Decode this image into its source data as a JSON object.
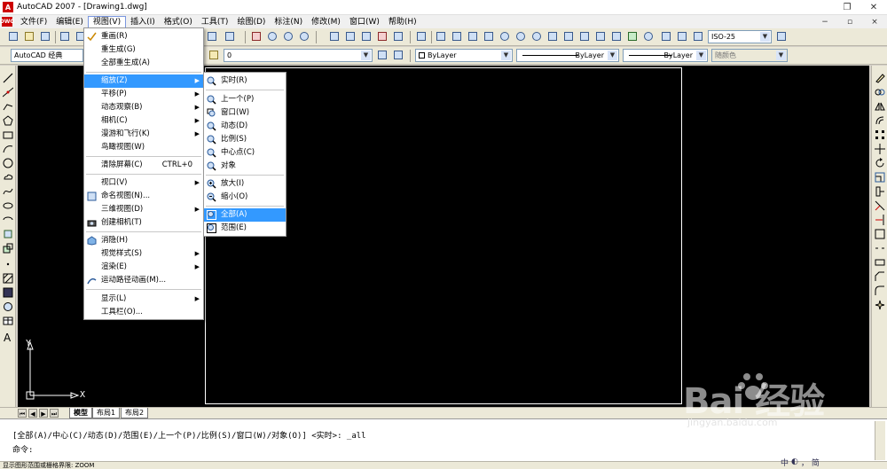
{
  "window": {
    "title": "AutoCAD 2007 - [Drawing1.dwg]",
    "app_icon": "A",
    "buttons": [
      "restore-icon",
      "close-icon"
    ]
  },
  "menubar": {
    "mdi_icon": "DWG",
    "items": [
      "文件(F)",
      "编辑(E)",
      "视图(V)",
      "插入(I)",
      "格式(O)",
      "工具(T)",
      "绘图(D)",
      "标注(N)",
      "修改(M)",
      "窗口(W)",
      "帮助(H)"
    ],
    "active_index": 2,
    "mdi_buttons": [
      "−",
      "▫",
      "×"
    ]
  },
  "toolbar": {
    "workspace": "AutoCAD 经典",
    "layer": "0",
    "dimstyle": "ISO-25",
    "color": "ByLayer",
    "linetype": "ByLayer",
    "lineweight": "ByLayer",
    "plotstyle": "随颜色"
  },
  "view_menu": {
    "items": [
      {
        "label": "重画(R)",
        "icon": "checkmark-pencil-icon"
      },
      {
        "label": "重生成(G)"
      },
      {
        "label": "全部重生成(A)"
      },
      {
        "label": "缩放(Z)",
        "submenu": true,
        "highlighted": true
      },
      {
        "label": "平移(P)",
        "submenu": true
      },
      {
        "label": "动态观察(B)",
        "submenu": true
      },
      {
        "label": "相机(C)",
        "submenu": true
      },
      {
        "label": "漫游和飞行(K)",
        "submenu": true
      },
      {
        "label": "鸟瞰视图(W)"
      },
      {
        "label": "清除屏幕(C)",
        "shortcut": "CTRL+0"
      },
      {
        "label": "视口(V)",
        "submenu": true
      },
      {
        "label": "命名视图(N)..."
      },
      {
        "label": "三维视图(D)",
        "submenu": true
      },
      {
        "label": "创建相机(T)"
      },
      {
        "label": "消隐(H)"
      },
      {
        "label": "视觉样式(S)",
        "submenu": true
      },
      {
        "label": "渲染(E)",
        "submenu": true
      },
      {
        "label": "运动路径动画(M)..."
      },
      {
        "label": "显示(L)",
        "submenu": true
      },
      {
        "label": "工具栏(O)..."
      }
    ]
  },
  "zoom_menu": {
    "items": [
      {
        "label": "实时(R)"
      },
      {
        "label": "上一个(P)"
      },
      {
        "label": "窗口(W)"
      },
      {
        "label": "动态(D)"
      },
      {
        "label": "比例(S)"
      },
      {
        "label": "中心点(C)"
      },
      {
        "label": "对象"
      },
      {
        "label": "放大(I)"
      },
      {
        "label": "缩小(O)"
      },
      {
        "label": "全部(A)",
        "highlighted": true
      },
      {
        "label": "范围(E)"
      }
    ]
  },
  "ucs": {
    "x": "X",
    "y": "Y"
  },
  "layout_tabs": [
    "模型",
    "布局1",
    "布局2"
  ],
  "command": {
    "line1": "[全部(A)/中心(C)/动态(D)/范围(E)/上一个(P)/比例(S)/窗口(W)/对象(O)] <实时>: _all",
    "line2": "命令:"
  },
  "status": {
    "message": "显示图形范围或栅格界限: ZOOM"
  },
  "watermark": {
    "brand": "Bai  经验",
    "url": "jingyan.baidu.com"
  },
  "tray": [
    "中",
    "◐",
    "，",
    "简"
  ],
  "colors": {
    "drawing_bg": "#000000",
    "menu_highlight": "#3399ff",
    "toolbar_bg": "#ece9d8"
  }
}
